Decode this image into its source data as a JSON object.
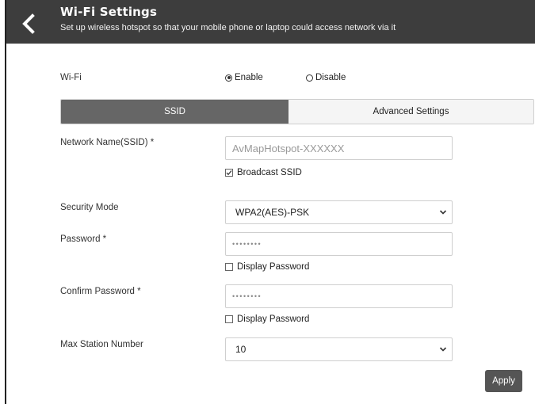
{
  "header": {
    "title": "Wi-Fi Settings",
    "subtitle": "Set up wireless hotspot so that your mobile phone or laptop could access network via it",
    "back_icon": "chevron-left-icon"
  },
  "wifi": {
    "label": "Wi-Fi",
    "enable_label": "Enable",
    "disable_label": "Disable",
    "selected": "Enable"
  },
  "tabs": [
    {
      "label": "SSID",
      "active": true
    },
    {
      "label": "Advanced Settings",
      "active": false
    }
  ],
  "form": {
    "ssid_label": "Network Name(SSID) *",
    "ssid_placeholder": "AvMapHotspot-XXXXXX",
    "broadcast_label": "Broadcast SSID",
    "broadcast_checked": true,
    "security_label": "Security Mode",
    "security_value": "WPA2(AES)-PSK",
    "password_label": "Password *",
    "password_value": "••••••••",
    "display_password_label": "Display Password",
    "confirm_label": "Confirm Password *",
    "confirm_value": "••••••••",
    "display_password2_label": "Display Password",
    "max_station_label": "Max Station Number",
    "max_station_value": "10"
  },
  "actions": {
    "apply_label": "Apply"
  },
  "colors": {
    "header_bg": "#3d3d3d",
    "tab_active_bg": "#666666",
    "button_bg": "#555555"
  }
}
